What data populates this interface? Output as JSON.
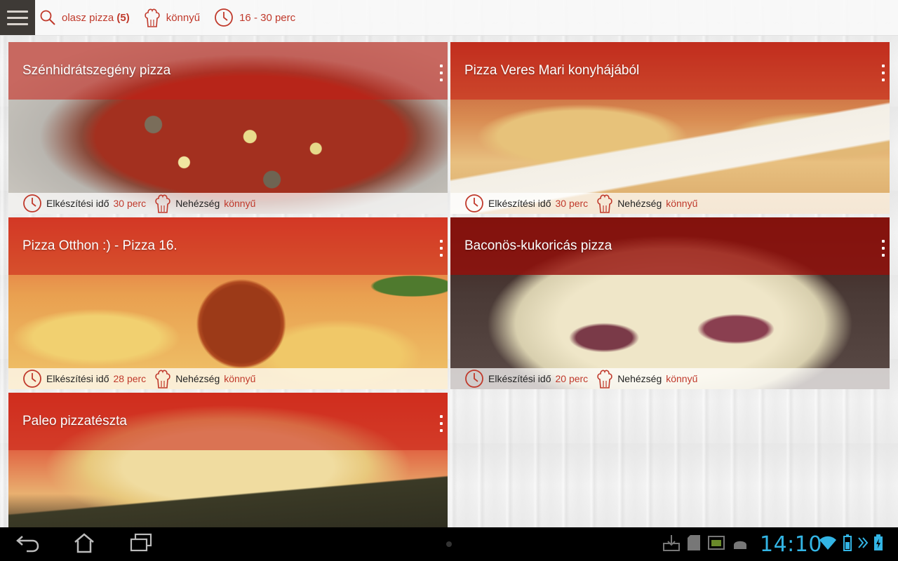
{
  "topbar": {
    "menu_icon": "hamburger-icon",
    "filters": [
      {
        "icon": "search-icon",
        "label": "olasz pizza",
        "count": "(5)"
      },
      {
        "icon": "chef-hat-icon",
        "label": "könnyű"
      },
      {
        "icon": "clock-icon",
        "label": "16 - 30 perc"
      }
    ]
  },
  "cards": [
    {
      "title": "Szénhidrátszegény pizza",
      "time_label": "Elkészítési idő",
      "time_value": "30 perc",
      "difficulty_label": "Nehézség",
      "difficulty_value": "könnyű"
    },
    {
      "title": "Pizza Veres Mari konyhájából",
      "time_label": "Elkészítési idő",
      "time_value": "30 perc",
      "difficulty_label": "Nehézség",
      "difficulty_value": "könnyű"
    },
    {
      "title": "Pizza Otthon :) - Pizza 16.",
      "time_label": "Elkészítési idő",
      "time_value": "28 perc",
      "difficulty_label": "Nehézség",
      "difficulty_value": "könnyű"
    },
    {
      "title": "Baconös-kukoricás pizza",
      "time_label": "Elkészítési idő",
      "time_value": "20 perc",
      "difficulty_label": "Nehézség",
      "difficulty_value": "könnyű"
    },
    {
      "title": "Paleo pizzatészta"
    }
  ],
  "system_bar": {
    "clock": "14:10",
    "accent": "#33b5e5",
    "nav_icons": [
      "back-icon",
      "home-icon",
      "recent-apps-icon"
    ],
    "status_icons": [
      "download-icon",
      "sd-card-icon",
      "screenshot-icon",
      "android-icon",
      "wifi-icon",
      "battery-icon",
      "forward-icon",
      "battery-charging-icon"
    ]
  },
  "colors": {
    "accent_red": "#c0392b",
    "title_overlay": "#c81e14"
  }
}
